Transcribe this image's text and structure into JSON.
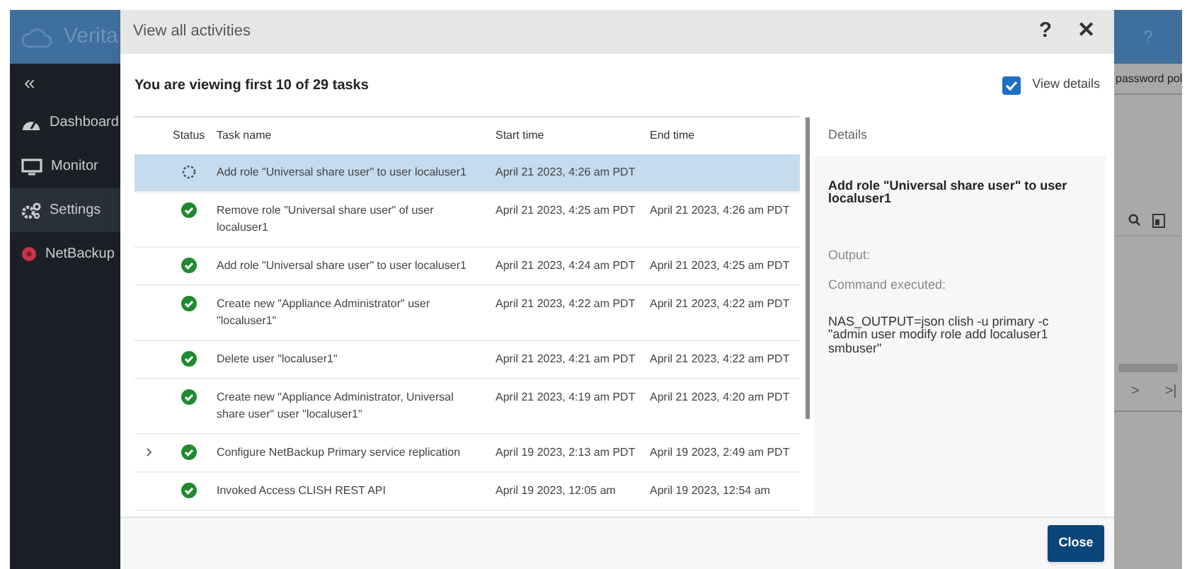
{
  "app": {
    "brand": "Verita",
    "help": "?",
    "collapse": "«",
    "nav": [
      {
        "label": "Dashboard",
        "selected": false
      },
      {
        "label": "Monitor",
        "selected": false
      },
      {
        "label": "Settings",
        "selected": true
      },
      {
        "label": "NetBackup",
        "selected": false
      }
    ],
    "behind": {
      "tab": "password pol",
      "pager_next": ">",
      "pager_last": ">|"
    }
  },
  "dialog": {
    "title": "View all activities",
    "help": "?",
    "close": "✕",
    "summary": "You are viewing first 10 of 29 tasks",
    "view_details": {
      "label": "View details",
      "checked": true
    },
    "columns": [
      "Status",
      "Task name",
      "Start time",
      "End time"
    ],
    "rows": [
      {
        "kind": "running",
        "task": "Add role \"Universal share user\" to user localuser1",
        "start": "April 21 2023, 4:26 am PDT",
        "end": "",
        "selected": true,
        "expandable": false
      },
      {
        "kind": "success",
        "task": "Remove role \"Universal share user\" of user localuser1",
        "start": "April 21 2023, 4:25 am PDT",
        "end": "April 21 2023, 4:26 am PDT",
        "selected": false,
        "expandable": false
      },
      {
        "kind": "success",
        "task": "Add role \"Universal share user\" to user localuser1",
        "start": "April 21 2023, 4:24 am PDT",
        "end": "April 21 2023, 4:25 am PDT",
        "selected": false,
        "expandable": false
      },
      {
        "kind": "success",
        "task": "Create new \"Appliance Administrator\" user \"localuser1\"",
        "start": "April 21 2023, 4:22 am PDT",
        "end": "April 21 2023, 4:22 am PDT",
        "selected": false,
        "expandable": false
      },
      {
        "kind": "success",
        "task": "Delete user \"localuser1\"",
        "start": "April 21 2023, 4:21 am PDT",
        "end": "April 21 2023, 4:22 am PDT",
        "selected": false,
        "expandable": false
      },
      {
        "kind": "success",
        "task": "Create new \"Appliance Administrator, Universal share user\" user \"localuser1\"",
        "start": "April 21 2023, 4:19 am PDT",
        "end": "April 21 2023, 4:20 am PDT",
        "selected": false,
        "expandable": false
      },
      {
        "kind": "success",
        "task": "Configure NetBackup Primary service replication",
        "start": "April 19 2023, 2:13 am PDT",
        "end": "April 19 2023, 2:49 am PDT",
        "selected": false,
        "expandable": true
      },
      {
        "kind": "success",
        "task": "Invoked Access CLISH REST API",
        "start": "April 19 2023, 12:05 am",
        "end": "April 19 2023, 12:54 am",
        "selected": false,
        "expandable": false
      }
    ],
    "details": {
      "heading": "Details",
      "task": "Add role \"Universal share user\" to user localuser1",
      "output_label": "Output:",
      "command_label": "Command executed:",
      "command": "NAS_OUTPUT=json clish -u primary -c \"admin user modify role add localuser1 smbuser\""
    },
    "close_button": "Close"
  }
}
